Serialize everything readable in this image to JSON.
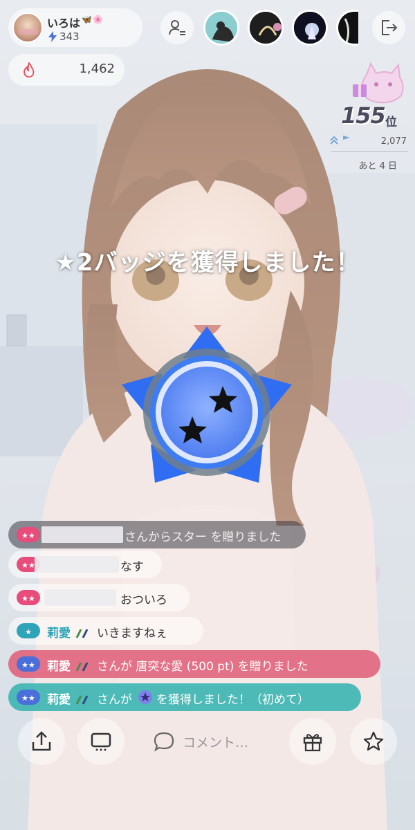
{
  "profile": {
    "name": "いろは",
    "deco": "🦋🌸",
    "count": "343"
  },
  "fire": {
    "count": "1,462"
  },
  "ranking": {
    "rank": "155",
    "suffix": "位",
    "points": "2,077",
    "days_left": "あと 4 日"
  },
  "announcement": {
    "title": "★2バッジを獲得しました！"
  },
  "chat": [
    {
      "badge": "★★",
      "name": "",
      "text": "さんからスター を贈りました",
      "style": "dark"
    },
    {
      "badge": "★★",
      "name": "",
      "text": "なす",
      "style": "light"
    },
    {
      "badge": "★★",
      "name": "",
      "text": "おついろ",
      "style": "light"
    },
    {
      "badge": "★",
      "name": "莉愛",
      "text": "いきますねぇ",
      "style": "light"
    },
    {
      "badge": "★★",
      "name": "莉愛",
      "text": "さんが 唐突な愛 (500 pt) を贈りました",
      "style": "gift"
    },
    {
      "badge": "★★",
      "name": "莉愛",
      "text_before": "さんが",
      "text_after": "を獲得しました！（初めて）",
      "style": "badge"
    }
  ],
  "bottom_bar": {
    "comment_placeholder": "コメント…",
    "buttons": [
      "share-icon",
      "screen-icon",
      "chat-bubble-icon",
      "gift-icon",
      "star-icon"
    ]
  },
  "colors": {
    "badge_blue": "#3b82f6",
    "gift_row": "#e0607a",
    "badge_row": "#35b3b0",
    "star_badge_pink": "#e74c7a",
    "star_badge_blue": "#4a6fd8"
  }
}
